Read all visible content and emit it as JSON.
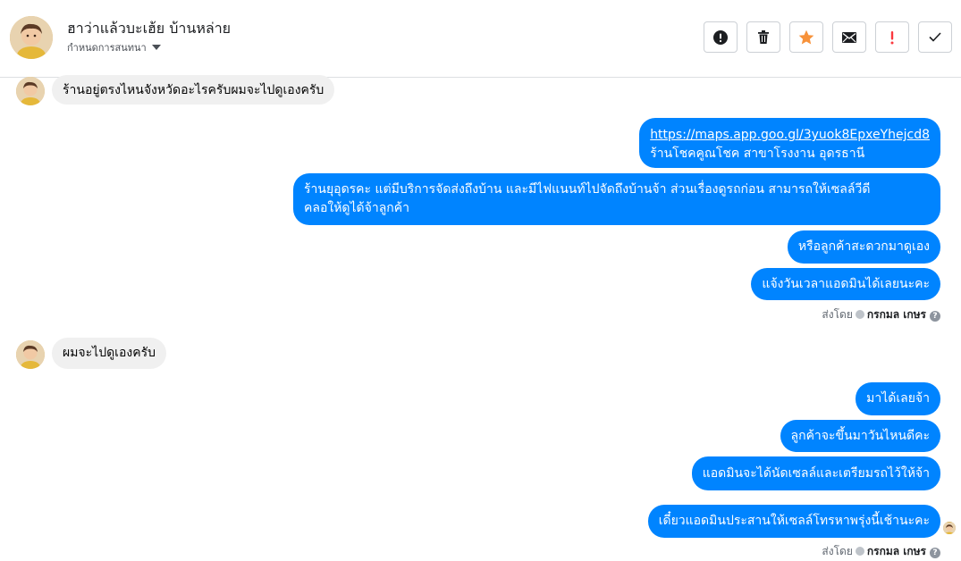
{
  "header": {
    "contact_name": "ฮาว่าแล้วบะเฮ้ย บ้านหล่าย",
    "conversation_settings": "กำหนดการสนทนา",
    "actions": [
      {
        "name": "report-icon",
        "label": "!"
      },
      {
        "name": "trash-icon",
        "label": "delete"
      },
      {
        "name": "star-icon",
        "label": "star"
      },
      {
        "name": "mail-icon",
        "label": "mail"
      },
      {
        "name": "important-icon",
        "label": "!"
      },
      {
        "name": "check-icon",
        "label": "done"
      }
    ],
    "colors": {
      "star": "#f7923a",
      "important": "#fa383e"
    }
  },
  "messages": {
    "m1": "ร้านอยู่ตรงไหนจังหวัดอะไรครับผมจะไปดูเองครับ",
    "m2_link": "https://maps.app.goo.gl/3yuok8EpxeYhejcd8",
    "m2_text": "ร้านโชคคูณโชค สาขาโรงงาน อุดรธานี",
    "m3_line1": "ร้านยุอุดรคะ แต่มีบริการจัดส่งถึงบ้าน และมีไฟแนนท์ไปจัดถึงบ้านจ้า ส่วนเรื่องดูรถก่อน สามารถให้เซลล์วีดี",
    "m3_line2": "คลอให้ดูได้จ้าลูกค้า",
    "m4": "หรือลูกค้าสะดวกมาดูเอง",
    "m5": "แจ้งวันเวลาแอดมินได้เลยนะคะ",
    "m6": "ผมจะไปดูเองครับ",
    "m7": "มาได้เลยจ้า",
    "m8": "ลูกค้าจะขึ้นมาวันไหนดีคะ",
    "m9": "แอดมินจะได้นัดเซลล์และเตรียมรถไว้ให้จ้า",
    "m10": "เดี๋ยวแอดมินประสานให้เซลล์โทรหาพรุ่งนี้เช้านะคะ"
  },
  "sent_by": {
    "prefix": "ส่งโดย",
    "author": "กรกมล เกษร",
    "help": "?"
  },
  "colors": {
    "outgoing": "#0084ff",
    "incoming": "#f0f0f0"
  }
}
